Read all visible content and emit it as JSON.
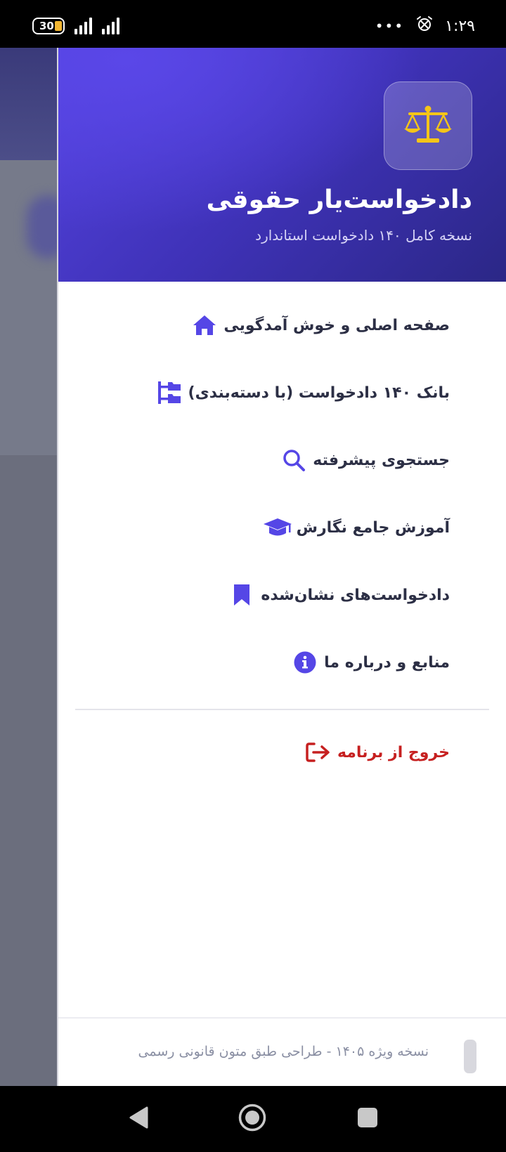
{
  "status_bar": {
    "battery_level": "30",
    "time": "۱:۲۹",
    "overflow_dots": "•••"
  },
  "drawer": {
    "header": {
      "app_icon": "scale-balance-icon",
      "title": "دادخواست‌یار حقوقی",
      "subtitle": "نسخه کامل ۱۴۰ دادخواست استاندارد"
    },
    "menu_items": [
      {
        "label": "صفحه اصلی و خوش آمدگویی",
        "icon": "home-icon"
      },
      {
        "label": "بانک ۱۴۰ دادخواست (با دسته‌بندی)",
        "icon": "category-tree-icon"
      },
      {
        "label": "جستجوی پیشرفته",
        "icon": "search-icon"
      },
      {
        "label": "آموزش جامع نگارش",
        "icon": "graduation-cap-icon"
      },
      {
        "label": "دادخواست‌های نشان‌شده",
        "icon": "bookmark-icon"
      },
      {
        "label": "منابع و درباره ما",
        "icon": "info-circle-icon"
      }
    ],
    "exit_item": {
      "label": "خروج از برنامه",
      "icon": "sign-out-icon"
    },
    "footer_text": "نسخه ویژه ۱۴۰۵ - طراحی طبق متون قانونی رسمی"
  },
  "nav_bar": {
    "back_icon": "back-triangle-icon",
    "home_icon": "home-circle-icon",
    "recents_icon": "recents-square-icon"
  },
  "colors": {
    "accent": "#5546e6",
    "header_gradient_start": "#5443df",
    "header_gradient_end": "#2b2786",
    "logo_gold": "#f5c518",
    "menu_text": "#2c2f45",
    "exit_red": "#c62020",
    "footer_text": "#8a8fa3"
  }
}
